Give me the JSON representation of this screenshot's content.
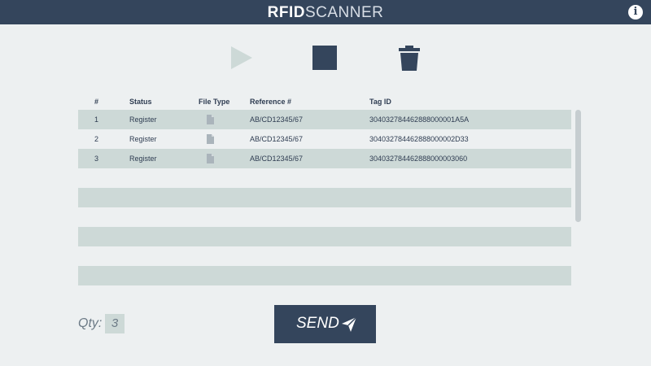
{
  "app": {
    "title_bold": "RFID",
    "title_light": "SCANNER",
    "info_label": "i"
  },
  "toolbar": {
    "play_icon": "play-icon",
    "stop_icon": "stop-icon",
    "delete_icon": "trash-icon"
  },
  "table": {
    "headers": {
      "num": "#",
      "status": "Status",
      "file_type": "File Type",
      "reference": "Reference #",
      "tag_id": "Tag ID"
    },
    "rows": [
      {
        "num": "1",
        "status": "Register",
        "file_icon": "file-icon",
        "reference": "AB/CD12345/67",
        "tag_id": "304032784462888000001A5A"
      },
      {
        "num": "2",
        "status": "Register",
        "file_icon": "file-icon",
        "reference": "AB/CD12345/67",
        "tag_id": "304032784462888000002D33"
      },
      {
        "num": "3",
        "status": "Register",
        "file_icon": "file-icon",
        "reference": "AB/CD12345/67",
        "tag_id": "304032784462888000003060"
      }
    ]
  },
  "footer": {
    "qty_label": "Qty:",
    "qty_value": "3",
    "send_label": "SEND",
    "send_icon": "paper-plane-icon"
  },
  "colors": {
    "header_bg": "#34455c",
    "row_shade": "#cdd9d7",
    "page_bg": "#edf0f1",
    "play_icon": "#cdd9d7"
  }
}
